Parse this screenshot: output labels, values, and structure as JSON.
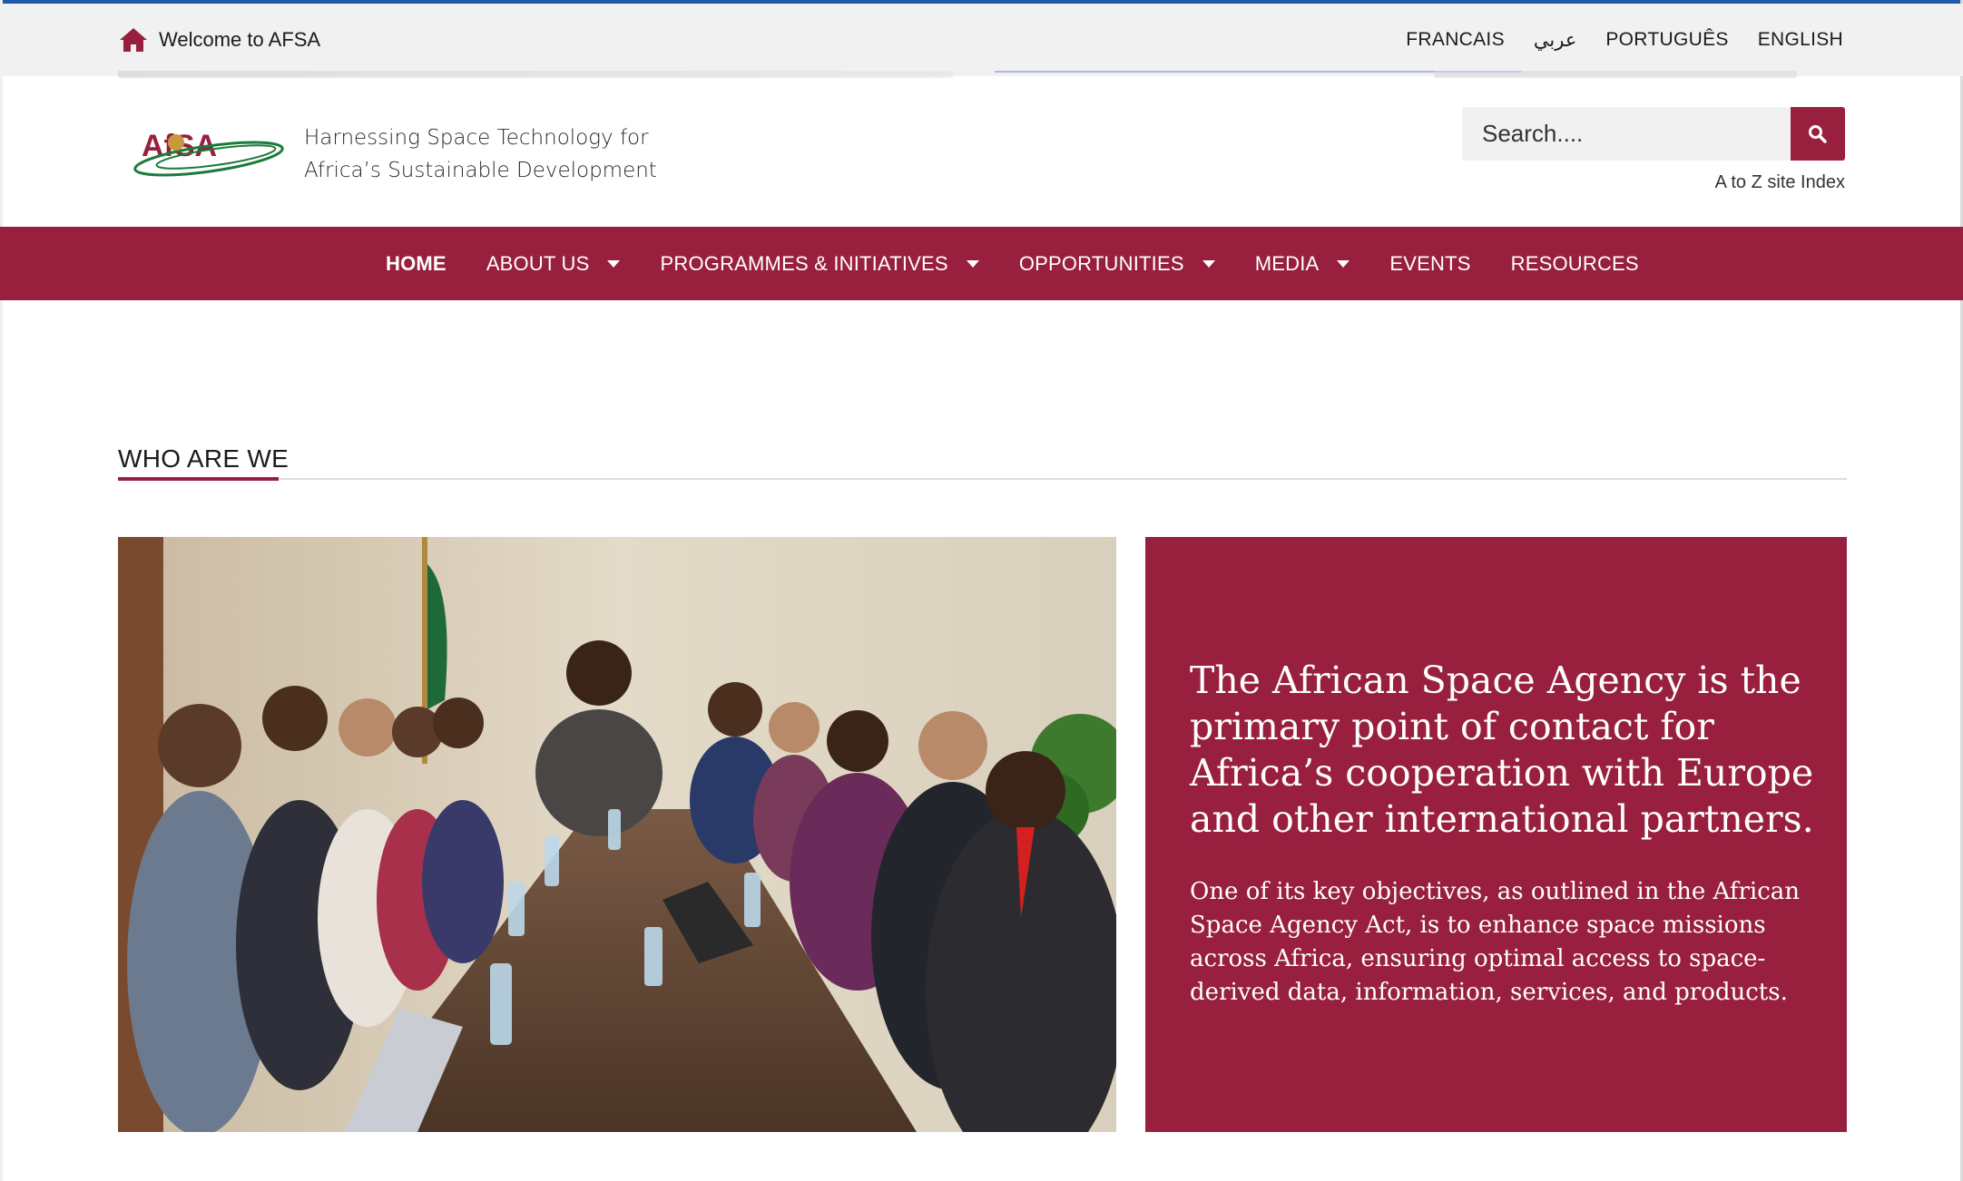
{
  "topbar": {
    "welcome_text": "Welcome to AFSA",
    "languages": [
      "FRANCAIS",
      "عربي",
      "PORTUGUÊS",
      "ENGLISH"
    ]
  },
  "header": {
    "logo_text": "AfSA",
    "tagline_line1": "Harnessing Space Technology for",
    "tagline_line2": "Africa’s Sustainable Development",
    "search_placeholder": "Search....",
    "atoz_label": "A to Z site Index"
  },
  "nav": {
    "items": [
      {
        "label": "HOME",
        "dropdown": false,
        "active": true
      },
      {
        "label": "ABOUT US",
        "dropdown": true
      },
      {
        "label": "PROGRAMMES & INITIATIVES",
        "dropdown": true
      },
      {
        "label": "OPPORTUNITIES",
        "dropdown": true
      },
      {
        "label": "MEDIA",
        "dropdown": true
      },
      {
        "label": "EVENTS",
        "dropdown": false
      },
      {
        "label": "RESOURCES",
        "dropdown": false
      }
    ]
  },
  "section": {
    "title": "WHO ARE WE"
  },
  "card": {
    "lead": "The African Space Agency is the primary point of contact for Africa’s cooperation with Europe and other international partners.",
    "body": "One of its key objectives, as outlined in the African Space Agency Act, is to enhance space missions across Africa, ensuring optimal access to space-derived data, information, services, and products."
  },
  "colors": {
    "brand": "#98203e",
    "topbar_bg": "#f1f1f1",
    "accent_blue": "#1f5aa6"
  },
  "icons": {
    "home": "home-icon",
    "search": "search-icon",
    "dropdown": "caret-down-icon"
  }
}
